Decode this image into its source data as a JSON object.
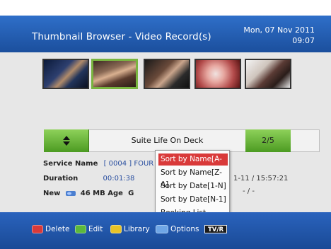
{
  "header": {
    "title": "Thumbnail Browser - Video Record(s)",
    "date": "Mon, 07 Nov 2011",
    "time": "09:07"
  },
  "thumbnails": [
    {
      "name": "thumb-1"
    },
    {
      "name": "thumb-2",
      "selected": true
    },
    {
      "name": "thumb-3"
    },
    {
      "name": "thumb-4"
    },
    {
      "name": "thumb-5"
    }
  ],
  "navigator": {
    "title": "Suite Life On Deck",
    "page": "2/5"
  },
  "details": {
    "service_label": "Service Name",
    "service_value": "[ 0004 ]  FOUR",
    "duration_label": "Duration",
    "duration_value": "00:01:38",
    "new_label": "New",
    "size_value": "46 MB Age",
    "age_value": "G",
    "timestamp_partial": "1-11 / 15:57:21",
    "dash_partial": "- / -"
  },
  "sort_menu": {
    "items": [
      "Sort by Name[A-Z]",
      "Sort by Name[Z-A]",
      "Sort by Date[1-N]",
      "Sort by Date[N-1]",
      "Booking List"
    ],
    "selected_index": 0
  },
  "footer": {
    "delete_label": "Delete",
    "edit_label": "Edit",
    "library_label": "Library",
    "options_label": "Options",
    "tvr_label": "TV/R",
    "colors": {
      "red": "#d83a3a",
      "green": "#5cb83c",
      "yellow": "#e8c327",
      "blue": "#6fa6e6"
    }
  }
}
